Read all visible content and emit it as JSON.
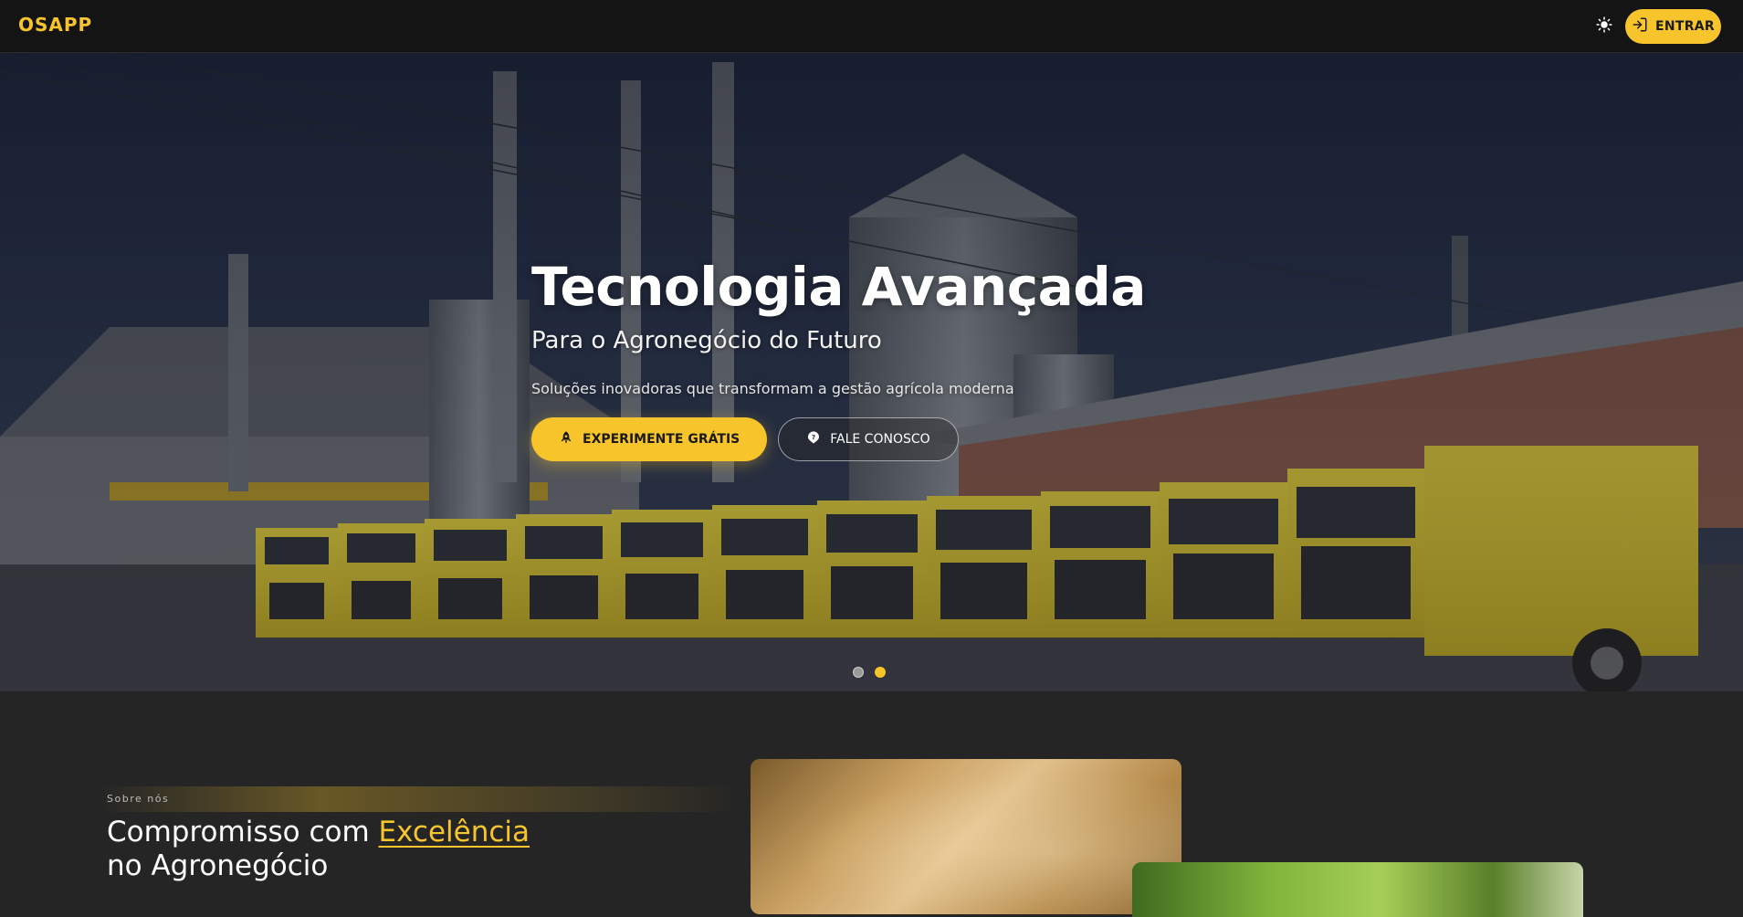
{
  "header": {
    "logo": "OSAPP",
    "theme_icon": "sun-icon",
    "login_label": "ENTRAR",
    "login_icon": "login-icon"
  },
  "hero": {
    "title": "Tecnologia Avançada",
    "subtitle": "Para o Agronegócio do Futuro",
    "description": "Soluções inovadoras que transformam a gestão agrícola moderna",
    "primary_cta": {
      "label": "EXPERIMENTE GRÁTIS",
      "icon": "rocket-icon"
    },
    "secondary_cta": {
      "label": "FALE CONOSCO",
      "icon": "help-icon"
    },
    "slides_total": 2,
    "active_slide": 2
  },
  "about": {
    "eyebrow": "Sobre nós",
    "title_prefix": "Compromisso com ",
    "title_highlight": "Excelência",
    "title_suffix": "no Agronegócio"
  },
  "colors": {
    "accent": "#f7c52b",
    "topbar_bg": "#141414",
    "page_bg": "#252525"
  }
}
